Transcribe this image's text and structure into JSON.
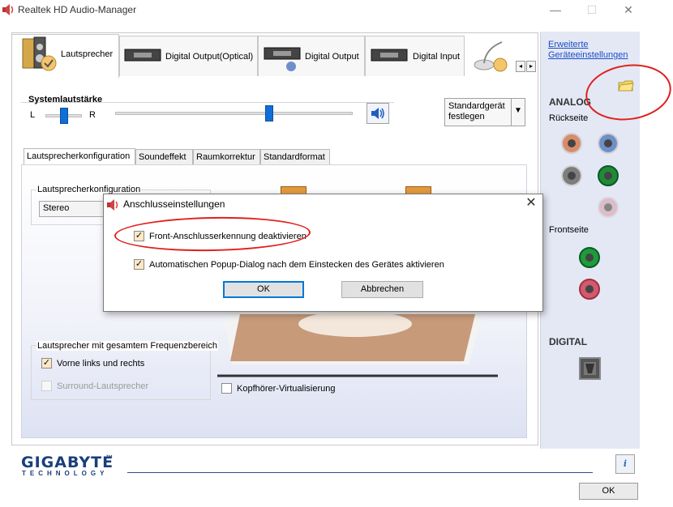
{
  "window": {
    "title": "Realtek HD Audio-Manager",
    "minimize_glyph": "—",
    "maximize_glyph": "☐",
    "close_glyph": "✕"
  },
  "device_tabs": [
    {
      "label": "Lautsprecher",
      "icon": "speaker-icon"
    },
    {
      "label": "Digital Output(Optical)",
      "icon": "optical-output-icon"
    },
    {
      "label": "Digital Output",
      "icon": "digital-output-icon"
    },
    {
      "label": "Digital Input",
      "icon": "digital-input-icon"
    }
  ],
  "tab_scroll": {
    "left": "◂",
    "right": "▸"
  },
  "volume": {
    "label": "Systemlautstärke",
    "left": "L",
    "right": "R",
    "balance": 0.5,
    "level": 0.65
  },
  "default_device": {
    "label": "Standardgerät festlegen",
    "arrow": "▼"
  },
  "sub_tabs": [
    "Lautsprecherkonfiguration",
    "Soundeffekt",
    "Raumkorrektur",
    "Standardformat"
  ],
  "speaker_config": {
    "group_title": "Lautsprecherkonfiguration",
    "selected": "Stereo"
  },
  "fullrange": {
    "group_title": "Lautsprecher mit gesamtem Frequenzbereich",
    "front": {
      "label": "Vorne links und rechts",
      "checked": true
    },
    "surround": {
      "label": "Surround-Lautsprecher",
      "checked": false,
      "disabled": true
    }
  },
  "headphone_virtualization": {
    "label": "Kopfhörer-Virtualisierung",
    "checked": false
  },
  "right_panel": {
    "advanced_link": "Erweiterte Geräteeinstellungen",
    "analog_heading": "ANALOG",
    "back_label": "Rückseite",
    "front_label": "Frontseite",
    "digital_heading": "DIGITAL",
    "jack_colors": {
      "orange": "#d98c6a",
      "blue": "#6f8fcb",
      "grey": "#7d7d7d",
      "green": "#1f8a3a",
      "pink": "#d9a0ac",
      "front_green": "#1f9a3c",
      "front_pink": "#d25a6e"
    }
  },
  "brand": {
    "name": "GIGABYTE",
    "sub": "TECHNOLOGY",
    "tm": "™"
  },
  "bottom": {
    "ok_label": "OK",
    "info_glyph": "i"
  },
  "dialog": {
    "title": "Anschlusseinstellungen",
    "close_glyph": "✕",
    "option1": {
      "label": "Front-Anschlusserkennung deaktivieren",
      "checked": true
    },
    "option2": {
      "label": "Automatischen Popup-Dialog nach dem Einstecken des Gerätes aktivieren",
      "checked": true
    },
    "ok_label": "OK",
    "cancel_label": "Abbrechen"
  },
  "checkmark": "✓",
  "colors": {
    "accent": "#0078d7",
    "link": "#1a4fc4",
    "annotation": "#e0201c",
    "brand": "#1a3f7a"
  }
}
